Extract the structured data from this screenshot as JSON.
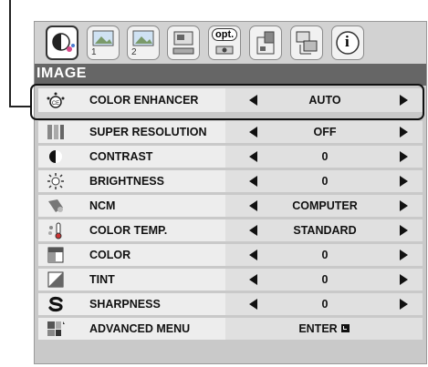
{
  "menu": {
    "header_title": "IMAGE",
    "tabs": [
      {
        "icon": "image-adjust-icon",
        "number": "",
        "active": true
      },
      {
        "icon": "picture-1-icon",
        "number": "1",
        "active": false
      },
      {
        "icon": "picture-2-icon",
        "number": "2",
        "active": false
      },
      {
        "icon": "screen-setup-icon",
        "number": "",
        "active": false
      },
      {
        "icon": "opt-icon",
        "number": "",
        "active": false
      },
      {
        "icon": "install-icon",
        "number": "",
        "active": false
      },
      {
        "icon": "network-icon",
        "number": "",
        "active": false
      },
      {
        "icon": "info-icon",
        "number": "",
        "active": false
      }
    ],
    "tab_opt_label": "opt.",
    "tab_info_label": "i",
    "items": [
      {
        "icon": "color-enhancer-icon",
        "label": "COLOR ENHANCER",
        "value": "AUTO"
      },
      {
        "icon": "super-resolution-icon",
        "label": "SUPER RESOLUTION",
        "value": "OFF"
      },
      {
        "icon": "contrast-icon",
        "label": "CONTRAST",
        "value": "0"
      },
      {
        "icon": "brightness-icon",
        "label": "BRIGHTNESS",
        "value": "0"
      },
      {
        "icon": "ncm-icon",
        "label": "NCM",
        "value": "COMPUTER"
      },
      {
        "icon": "color-temp-icon",
        "label": "COLOR TEMP.",
        "value": "STANDARD"
      },
      {
        "icon": "color-icon",
        "label": "COLOR",
        "value": "0"
      },
      {
        "icon": "tint-icon",
        "label": "TINT",
        "value": "0"
      },
      {
        "icon": "sharpness-icon",
        "label": "SHARPNESS",
        "value": "0"
      },
      {
        "icon": "advanced-menu-icon",
        "label": "ADVANCED MENU",
        "value": "ENTER"
      }
    ]
  },
  "colors": {
    "header_bg": "#666666",
    "row_bg": "#ededed",
    "value_bg": "#e0e0e0",
    "panel_bg": "#c9c9c9"
  }
}
